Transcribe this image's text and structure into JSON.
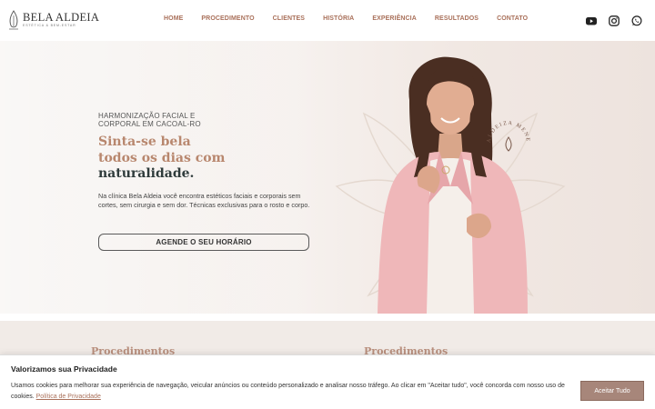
{
  "brand": {
    "name": "BELA ALDEIA",
    "tagline": "ESTÉTICA & BEM-ESTAR"
  },
  "nav": {
    "items": [
      {
        "label": "HOME"
      },
      {
        "label": "PROCEDIMENTO"
      },
      {
        "label": "CLIENTES"
      },
      {
        "label": "HISTÓRIA"
      },
      {
        "label": "EXPERIÊNCIA"
      },
      {
        "label": "RESULTADOS"
      },
      {
        "label": "CONTATO"
      }
    ]
  },
  "social": {
    "icons": [
      "youtube-icon",
      "instagram-icon",
      "whatsapp-icon"
    ]
  },
  "hero": {
    "eyebrow": "HARMONIZAÇÃO FACIAL E CORPORAL EM CACOAL-RO",
    "headline_1": "Sinta-se bela",
    "headline_2": "todos os dias com",
    "headline_3": "naturalidade.",
    "description": "Na clínica Bela Aldeia você encontra estéticos faciais e corporais sem cortes, sem cirurgia e sem dor. Técnicas exclusivas para o rosto e corpo.",
    "cta_label": "AGENDE O SEU HORÁRIO",
    "badge_text": "ALDEIZA MENEZES"
  },
  "sections": {
    "left_title": "Procedimentos",
    "right_title": "Procedimentos"
  },
  "cookie": {
    "title": "Valorizamos sua Privacidade",
    "text": "Usamos cookies para melhorar sua experiência de navegação, veicular anúncios ou conteúdo personalizado e analisar nosso tráfego. Ao clicar em \"Aceitar tudo\", você concorda com nosso uso de cookies.",
    "link_label": "Política de Privacidade",
    "accept_label": "Aceitar Tudo"
  },
  "colors": {
    "accent": "#a9705a",
    "headline_accent": "#b8876e",
    "headline_dark": "#2f3b3b",
    "button_bg": "#a7867a"
  }
}
